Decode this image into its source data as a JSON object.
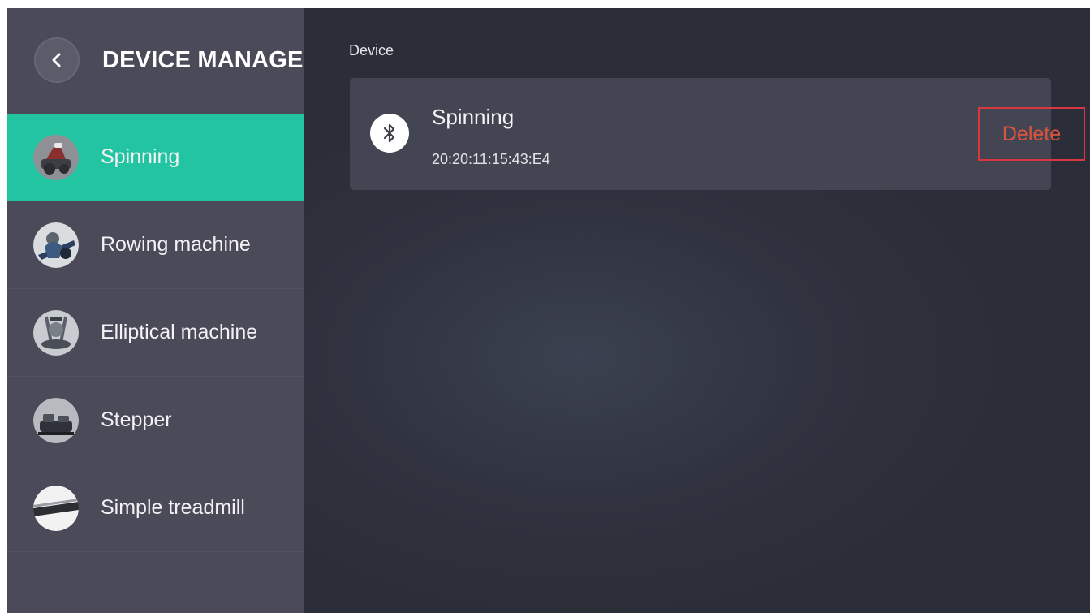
{
  "sidebar": {
    "title": "DEVICE MANAGE",
    "back_icon": "chevron-left-icon",
    "active_color": "#22c4a1",
    "items": [
      {
        "label": "Spinning",
        "icon": "spinning-bike-avatar",
        "active": true
      },
      {
        "label": "Rowing machine",
        "icon": "rowing-machine-avatar",
        "active": false
      },
      {
        "label": "Elliptical machine",
        "icon": "elliptical-machine-avatar",
        "active": false
      },
      {
        "label": "Stepper",
        "icon": "stepper-avatar",
        "active": false
      },
      {
        "label": "Simple treadmill",
        "icon": "treadmill-avatar",
        "active": false
      }
    ]
  },
  "main": {
    "section_label": "Device",
    "device": {
      "name": "Spinning",
      "mac": "20:20:11:15:43:E4",
      "icon": "bluetooth-icon",
      "delete_label": "Delete",
      "delete_color": "#e2533d"
    }
  }
}
